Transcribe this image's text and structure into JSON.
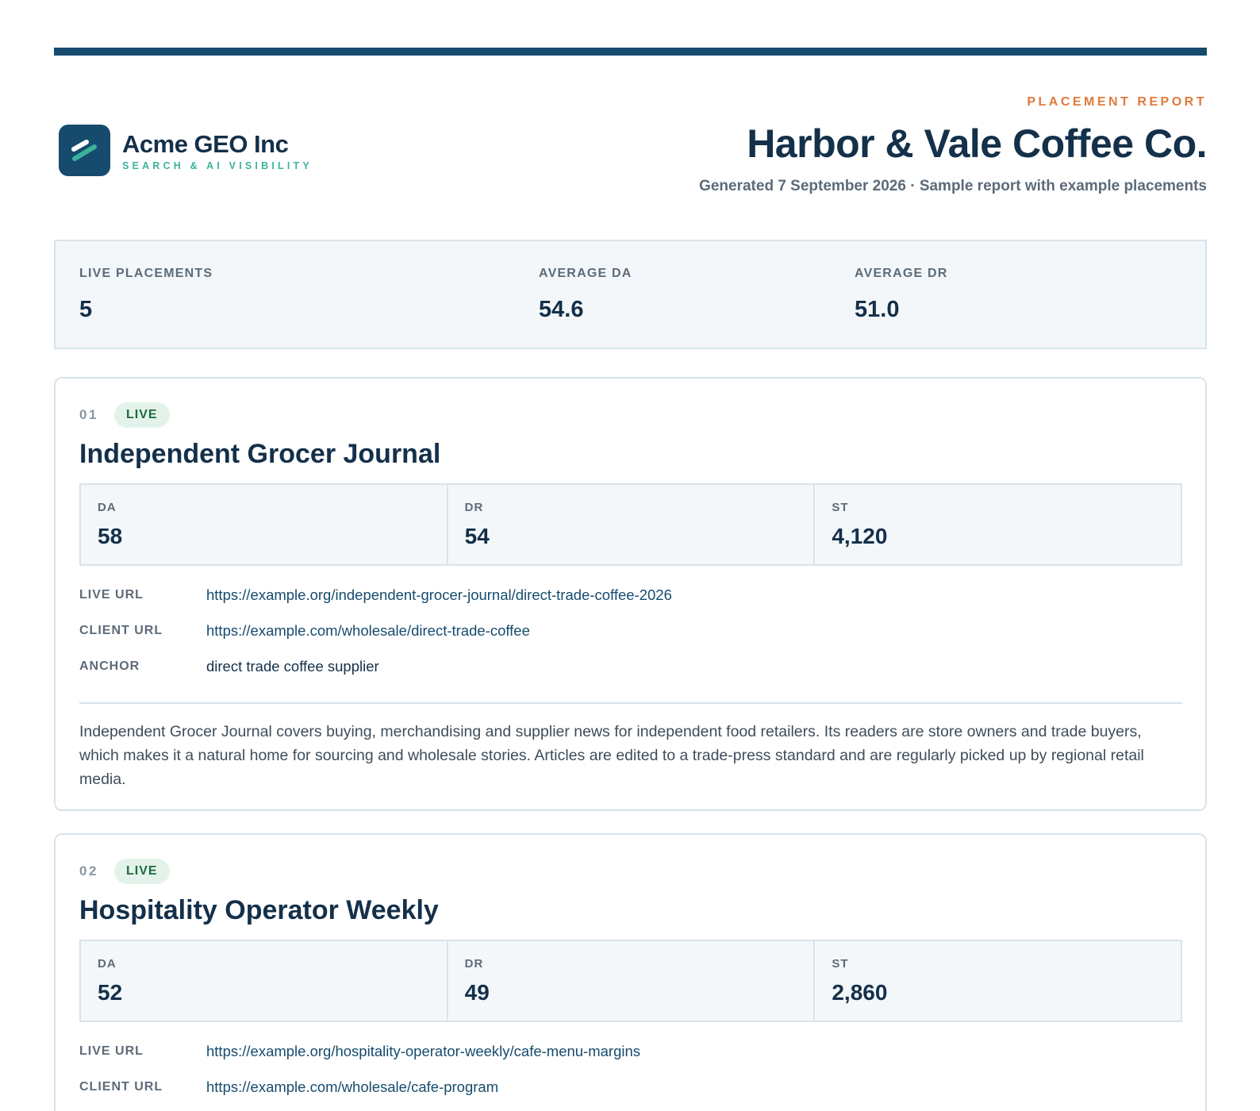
{
  "brand": {
    "name": "Acme GEO Inc",
    "tagline": "SEARCH & AI VISIBILITY"
  },
  "report": {
    "kicker": "PLACEMENT REPORT",
    "client": "Harbor & Vale Coffee Co.",
    "subtitle": "Generated 7 September 2026 · Sample report with example placements"
  },
  "summary": {
    "live_label": "LIVE PLACEMENTS",
    "live_value": "5",
    "da_label": "AVERAGE DA",
    "da_value": "54.6",
    "dr_label": "AVERAGE DR",
    "dr_value": "51.0"
  },
  "labels": {
    "da": "DA",
    "dr": "DR",
    "st": "ST",
    "live_url": "LIVE URL",
    "client_url": "CLIENT URL",
    "anchor": "ANCHOR"
  },
  "placements": [
    {
      "number": "01",
      "status": "LIVE",
      "title": "Independent Grocer Journal",
      "da": "58",
      "dr": "54",
      "st": "4,120",
      "live_url": "https://example.org/independent-grocer-journal/direct-trade-coffee-2026",
      "client_url": "https://example.com/wholesale/direct-trade-coffee",
      "anchor": "direct trade coffee supplier",
      "description": "Independent Grocer Journal covers buying, merchandising and supplier news for independent food retailers. Its readers are store owners and trade buyers, which makes it a natural home for sourcing and wholesale stories. Articles are edited to a trade-press standard and are regularly picked up by regional retail media."
    },
    {
      "number": "02",
      "status": "LIVE",
      "title": "Hospitality Operator Weekly",
      "da": "52",
      "dr": "49",
      "st": "2,860",
      "live_url": "https://example.org/hospitality-operator-weekly/cafe-menu-margins",
      "client_url": "https://example.com/wholesale/cafe-program"
    }
  ],
  "colors": {
    "primary": "#164b6e",
    "accent": "#e07a3a",
    "teal": "#3bb39b",
    "badge_bg": "#e3f3ea",
    "badge_text": "#1f6a3f"
  }
}
